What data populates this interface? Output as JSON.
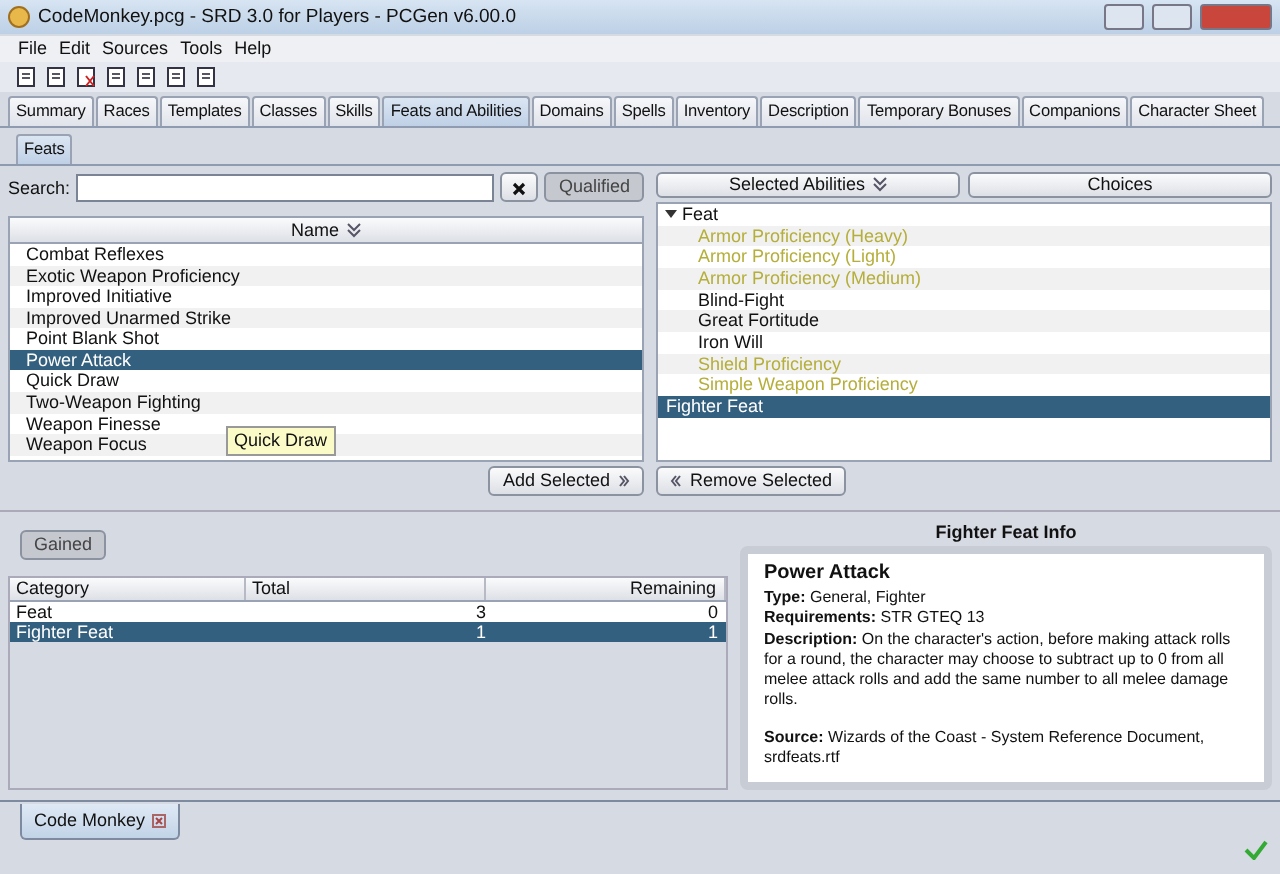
{
  "window": {
    "title": "CodeMonkey.pcg - SRD 3.0 for Players - PCGen v6.00.0"
  },
  "menu": [
    "File",
    "Edit",
    "Sources",
    "Tools",
    "Help"
  ],
  "tabs": [
    {
      "label": "Summary",
      "selected": false
    },
    {
      "label": "Races",
      "selected": false
    },
    {
      "label": "Templates",
      "selected": false
    },
    {
      "label": "Classes",
      "selected": false
    },
    {
      "label": "Skills",
      "selected": false
    },
    {
      "label": "Feats and Abilities",
      "selected": true
    },
    {
      "label": "Domains",
      "selected": false
    },
    {
      "label": "Spells",
      "selected": false
    },
    {
      "label": "Inventory",
      "selected": false
    },
    {
      "label": "Description",
      "selected": false
    },
    {
      "label": "Temporary Bonuses",
      "selected": false
    },
    {
      "label": "Companions",
      "selected": false
    },
    {
      "label": "Character Sheet",
      "selected": false
    }
  ],
  "subtabs": [
    {
      "label": "Feats",
      "selected": true
    }
  ],
  "available": {
    "search_label": "Search:",
    "qualified_button": "Qualified",
    "column": "Name",
    "rows": [
      {
        "name": "Combat Reflexes",
        "selected": false
      },
      {
        "name": "Exotic Weapon Proficiency",
        "selected": false
      },
      {
        "name": "Improved Initiative",
        "selected": false
      },
      {
        "name": "Improved Unarmed Strike",
        "selected": false
      },
      {
        "name": "Point Blank Shot",
        "selected": false
      },
      {
        "name": "Power Attack",
        "selected": true
      },
      {
        "name": "Quick Draw",
        "selected": false
      },
      {
        "name": "Two-Weapon Fighting",
        "selected": false
      },
      {
        "name": "Weapon Finesse",
        "selected": false
      },
      {
        "name": "Weapon Focus",
        "selected": false
      }
    ],
    "tooltip": "Quick Draw",
    "add_button": "Add Selected"
  },
  "selected": {
    "columns": [
      "Selected Abilities",
      "Choices"
    ],
    "tree": [
      {
        "label": "Feat",
        "expanded": true,
        "selected": false,
        "children": [
          {
            "label": "Armor Proficiency (Heavy)",
            "automatic": true,
            "selected": false
          },
          {
            "label": "Armor Proficiency (Light)",
            "automatic": true,
            "selected": false
          },
          {
            "label": "Armor Proficiency (Medium)",
            "automatic": true,
            "selected": false
          },
          {
            "label": "Blind-Fight",
            "automatic": false,
            "selected": false
          },
          {
            "label": "Great Fortitude",
            "automatic": false,
            "selected": false
          },
          {
            "label": "Iron Will",
            "automatic": false,
            "selected": false
          },
          {
            "label": "Shield Proficiency",
            "automatic": true,
            "selected": false
          },
          {
            "label": "Simple Weapon Proficiency",
            "automatic": true,
            "selected": false
          }
        ]
      },
      {
        "label": "Fighter Feat",
        "selected": true
      }
    ],
    "remove_button": "Remove Selected"
  },
  "gained": {
    "tab": "Gained",
    "columns": [
      "Category",
      "Total",
      "Remaining"
    ],
    "rows": [
      {
        "category": "Feat",
        "total": "3",
        "remaining": "0",
        "selected": false
      },
      {
        "category": "Fighter Feat",
        "total": "1",
        "remaining": "1",
        "selected": true
      }
    ]
  },
  "info": {
    "title": "Fighter Feat Info",
    "name": "Power Attack",
    "lines": [
      "**Type:** General, Fighter",
      "**Requirements:** STR GTEQ 13",
      "**Description:** On the character's action, before making attack rolls for a round, the character may choose to subtract up to 0 from all melee attack rolls and add the same number to all melee damage rolls."
    ],
    "source": "**Source:** Wizards of the Coast - System Reference Document, srdfeats.rtf"
  },
  "characters": [
    {
      "label": "Code Monkey",
      "selected": true
    }
  ]
}
